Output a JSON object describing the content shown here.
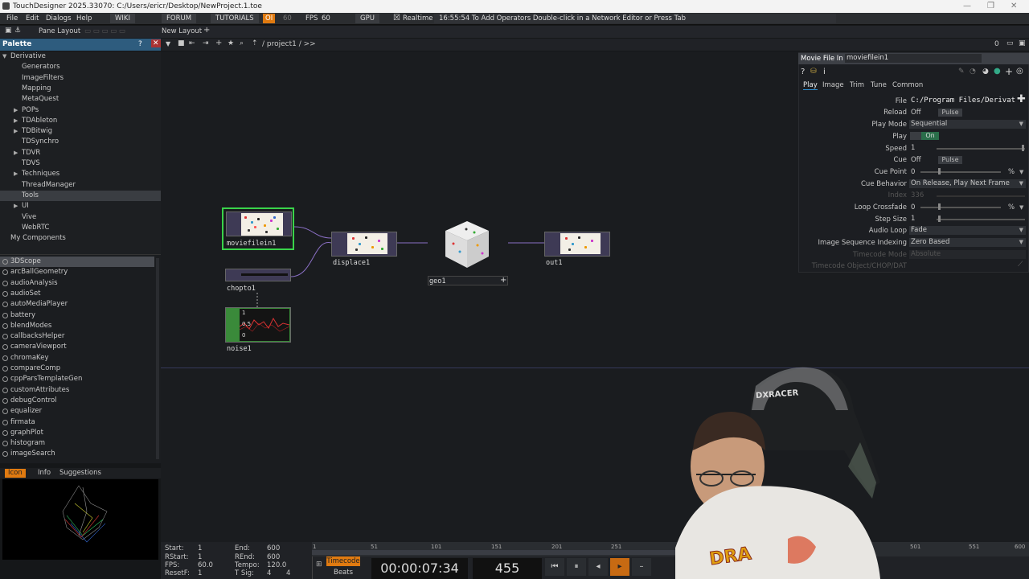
{
  "window": {
    "title": "TouchDesigner 2025.33070: C:/Users/ericr/Desktop/NewProject.1.toe",
    "minimize": "—",
    "restore": "❐",
    "close": "✕"
  },
  "menubar": {
    "items": [
      "File",
      "Edit",
      "Dialogs",
      "Help"
    ],
    "buttons": [
      "WIKI",
      "FORUM",
      "TUTORIALS"
    ],
    "oi": "OI",
    "oi_value": "60",
    "fps_label": "FPS",
    "fps_value": "60",
    "gpu": "GPU",
    "realtime": "Realtime",
    "status": "16:55:54 To Add Operators Double-click in a Network Editor or Press Tab"
  },
  "layoutbar": {
    "pane_layout": "Pane Layout",
    "new_layout": "New Layout",
    "plus": "+"
  },
  "palette": {
    "title": "Palette",
    "help": "?",
    "close": "✕",
    "tree": [
      {
        "label": "Derivative",
        "indent": 0,
        "arrow": "▼",
        "selected": false
      },
      {
        "label": "Generators",
        "indent": 2,
        "arrow": "",
        "selected": false
      },
      {
        "label": "ImageFilters",
        "indent": 2,
        "arrow": "",
        "selected": false
      },
      {
        "label": "Mapping",
        "indent": 2,
        "arrow": "",
        "selected": false
      },
      {
        "label": "MetaQuest",
        "indent": 2,
        "arrow": "",
        "selected": false
      },
      {
        "label": "POPs",
        "indent": 2,
        "arrow": "▶",
        "selected": false
      },
      {
        "label": "TDAbleton",
        "indent": 2,
        "arrow": "▶",
        "selected": false
      },
      {
        "label": "TDBitwig",
        "indent": 2,
        "arrow": "▶",
        "selected": false
      },
      {
        "label": "TDSynchro",
        "indent": 2,
        "arrow": "",
        "selected": false
      },
      {
        "label": "TDVR",
        "indent": 2,
        "arrow": "▶",
        "selected": false
      },
      {
        "label": "TDVS",
        "indent": 2,
        "arrow": "",
        "selected": false
      },
      {
        "label": "Techniques",
        "indent": 2,
        "arrow": "▶",
        "selected": false
      },
      {
        "label": "ThreadManager",
        "indent": 2,
        "arrow": "",
        "selected": false
      },
      {
        "label": "Tools",
        "indent": 2,
        "arrow": "",
        "selected": true
      },
      {
        "label": "UI",
        "indent": 2,
        "arrow": "▶",
        "selected": false
      },
      {
        "label": "Vive",
        "indent": 2,
        "arrow": "",
        "selected": false
      },
      {
        "label": "WebRTC",
        "indent": 2,
        "arrow": "",
        "selected": false
      },
      {
        "label": "My Components",
        "indent": 1,
        "arrow": "",
        "selected": false
      }
    ],
    "components": [
      "3DScope",
      "arcBallGeometry",
      "audioAnalysis",
      "audioSet",
      "autoMediaPlayer",
      "battery",
      "blendModes",
      "callbacksHelper",
      "cameraViewport",
      "chromaKey",
      "compareComp",
      "cppParsTemplateGen",
      "customAttributes",
      "debugControl",
      "equalizer",
      "firmata",
      "graphPlot",
      "histogram",
      "imageSearch"
    ],
    "selected_component": "3DScope",
    "bottom_tabs": [
      "Icon",
      "Info",
      "Suggestions"
    ],
    "active_bottom_tab": "Icon"
  },
  "network": {
    "path": "/ project1 / >>",
    "nodes": {
      "moviefilein1": "moviefilein1",
      "displace1": "displace1",
      "geo1": "geo1",
      "out1": "out1",
      "chopto1": "chopto1",
      "noise1": "noise1"
    },
    "noise_labels": [
      "1",
      "0.5",
      "0"
    ],
    "counter": "0"
  },
  "params": {
    "op_type": "Movie File In",
    "op_name": "moviefilein1",
    "tabs": [
      "Play",
      "Image",
      "Trim",
      "Tune",
      "Common"
    ],
    "active_tab": "Play",
    "rows": {
      "file_label": "File",
      "file_value": "C:/Program Files/Derivati",
      "reload_label": "Reload",
      "reload_value": "Off",
      "reload_pulse": "Pulse",
      "playmode_label": "Play Mode",
      "playmode_value": "Sequential",
      "play_label": "Play",
      "play_value": "On",
      "speed_label": "Speed",
      "speed_value": "1",
      "cue_label": "Cue",
      "cue_value": "Off",
      "cue_pulse": "Pulse",
      "cuepoint_label": "Cue Point",
      "cuepoint_value": "0",
      "cuepoint_unit": "%",
      "cuebehavior_label": "Cue Behavior",
      "cuebehavior_value": "On Release, Play Next Frame",
      "index_label": "Index",
      "index_value": "336",
      "loopcrossfade_label": "Loop Crossfade",
      "loopcrossfade_value": "0",
      "loopcrossfade_unit": "%",
      "stepsize_label": "Step Size",
      "stepsize_value": "1",
      "audioloop_label": "Audio Loop",
      "audioloop_value": "Fade",
      "imgseq_label": "Image Sequence Indexing",
      "imgseq_value": "Zero Based",
      "timecodemode_label": "Timecode Mode",
      "timecodemode_value": "Absolute",
      "timecodeobj_label": "Timecode Object/CHOP/DAT"
    }
  },
  "timebar": {
    "start_label": "Start:",
    "start": "1",
    "rstart_label": "RStart:",
    "rstart": "1",
    "fps_label": "FPS:",
    "fps": "60.0",
    "resetf_label": "ResetF:",
    "resetf": "1",
    "end_label": "End:",
    "end": "600",
    "rend_label": "REnd:",
    "rend": "600",
    "tempo_label": "Tempo:",
    "tempo": "120.0",
    "tsig_label": "T Sig:",
    "tsig_a": "4",
    "tsig_b": "4",
    "timecode_btn": "Timecode",
    "beats_btn": "Beats",
    "timecode": "00:00:07:34",
    "frame": "455",
    "ticks": [
      "1",
      "51",
      "101",
      "151",
      "201",
      "251",
      "501",
      "551",
      "600"
    ],
    "progress": 0.758
  },
  "colors": {
    "accent_orange": "#e07a10",
    "palette_head": "#2e5c7e",
    "selected_node": "#39d34a",
    "noise_node": "#3a8a3a"
  }
}
